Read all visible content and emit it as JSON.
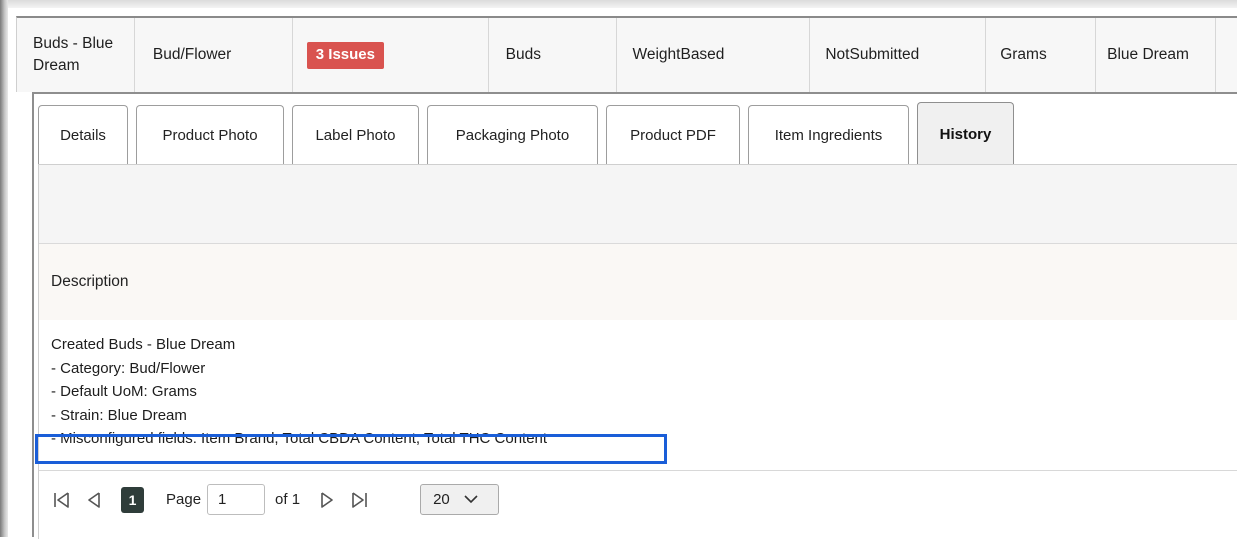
{
  "row": {
    "name": [
      "Buds - Blue",
      "Dream"
    ],
    "category": "Bud/Flower",
    "issues_badge": "3 Issues",
    "item_type": "Buds",
    "unit_type": "WeightBased",
    "status": "NotSubmitted",
    "uom": "Grams",
    "strain": "Blue Dream",
    "colors": {
      "badge": "#d9534f"
    }
  },
  "tabs": [
    {
      "label": "Details"
    },
    {
      "label": "Product Photo"
    },
    {
      "label": "Label Photo"
    },
    {
      "label": "Packaging Photo"
    },
    {
      "label": "Product PDF"
    },
    {
      "label": "Item Ingredients"
    },
    {
      "label": "History",
      "active": true
    }
  ],
  "history": {
    "column_header": "Description",
    "lines": [
      "Created Buds - Blue Dream",
      "- Category: Bud/Flower",
      "- Default UoM: Grams",
      "- Strain: Blue Dream",
      "- Misconfigured fields: Item Brand, Total CBDA Content, Total THC Content"
    ],
    "highlight_color": "#1a5ed8"
  },
  "pager": {
    "current_page": "1",
    "page_label": "Page",
    "page_input_value": "1",
    "of_label": "of 1",
    "page_size": "20",
    "icons": [
      "first-page-icon",
      "prev-page-icon",
      "next-page-icon",
      "last-page-icon",
      "chevron-down-icon"
    ]
  }
}
